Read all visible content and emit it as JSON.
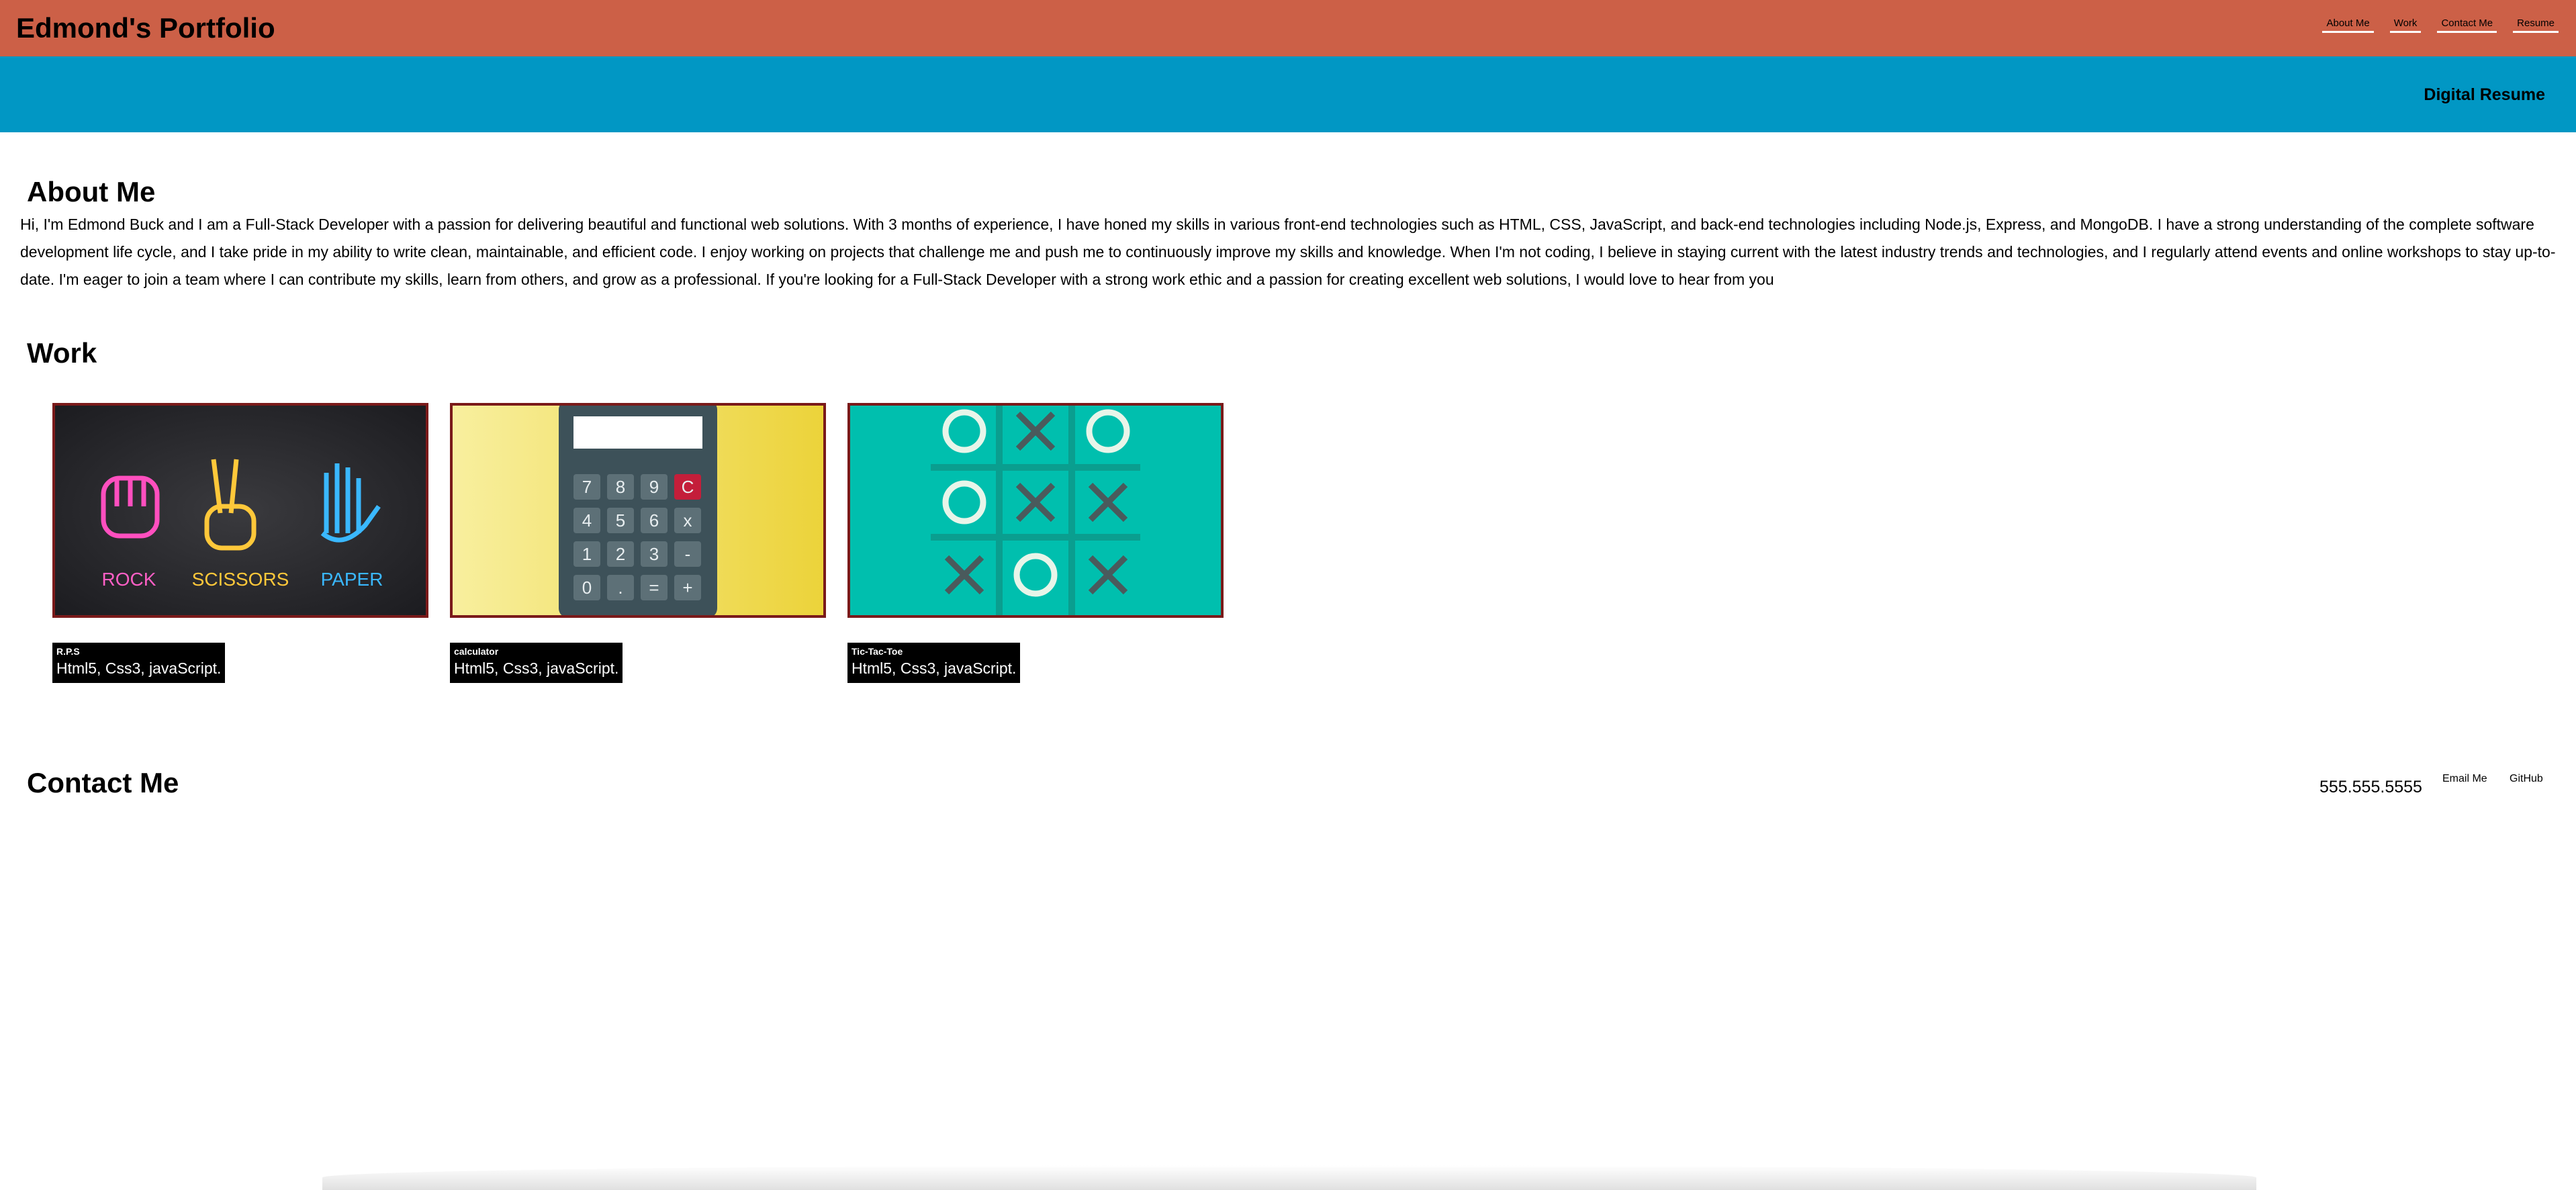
{
  "header": {
    "title": "Edmond's Portfolio",
    "nav": [
      "About Me",
      "Work",
      "Contact Me",
      "Resume"
    ]
  },
  "subbar": {
    "label": "Digital Resume"
  },
  "about": {
    "heading": "About Me",
    "text": "Hi, I'm Edmond Buck and I am a Full-Stack Developer with a passion for delivering beautiful and functional web solutions. With 3 months of experience, I have honed my skills in various front-end technologies such as HTML, CSS, JavaScript, and back-end technologies including Node.js, Express, and MongoDB. I have a strong understanding of the complete software development life cycle, and I take pride in my ability to write clean, maintainable, and efficient code. I enjoy working on projects that challenge me and push me to continuously improve my skills and knowledge. When I'm not coding, I believe in staying current with the latest industry trends and technologies, and I regularly attend events and online workshops to stay up-to-date. I'm eager to join a team where I can contribute my skills, learn from others, and grow as a professional. If you're looking for a Full-Stack Developer with a strong work ethic and a passion for creating excellent web solutions, I would love to hear from you"
  },
  "work": {
    "heading": "Work",
    "projects": [
      {
        "name": "R.P.S",
        "tech": "Html5, Css3, javaScript.",
        "image_labels": [
          "ROCK",
          "SCISSORS",
          "PAPER"
        ]
      },
      {
        "name": "calculator",
        "tech": "Html5, Css3, javaScript.",
        "keys": [
          "7",
          "8",
          "9",
          "C",
          "4",
          "5",
          "6",
          "x",
          "1",
          "2",
          "3",
          "-",
          "0",
          ".",
          "=",
          "+"
        ]
      },
      {
        "name": "Tic-Tac-Toe",
        "tech": "Html5, Css3, javaScript.",
        "board": [
          "O",
          "X",
          "O",
          "O",
          "X",
          "X",
          "X",
          "O",
          "X"
        ]
      }
    ]
  },
  "contact": {
    "heading": "Contact Me",
    "phone": "555.555.5555",
    "links": [
      "Email Me",
      "GitHub"
    ]
  },
  "colors": {
    "header_bg": "#cc6047",
    "subbar_bg": "#0197c4",
    "card_border": "#7a1a1a",
    "caption_bg": "#000000"
  }
}
